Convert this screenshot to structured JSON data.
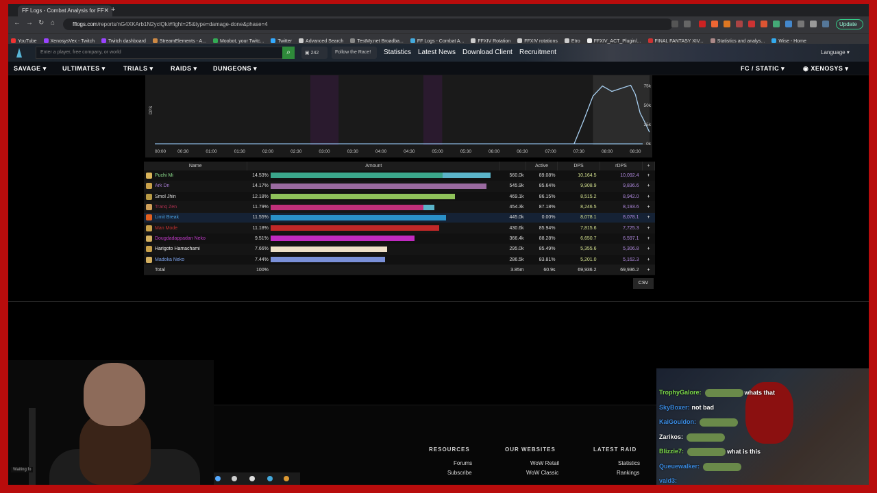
{
  "browser": {
    "tab_title": "FF Logs - Combat Analysis for FF",
    "url_domain": "fflogs.com",
    "url_path": "/reports/nG4XKArb1N2yclQk/#fight=25&type=damage-done&phase=4",
    "update_label": "Update",
    "bookmarks": [
      "YouTube",
      "XenosysVex - Twitch",
      "Twitch dashboard",
      "StreamElements - A...",
      "Moobot, your Twitc...",
      "Twitter",
      "Advanced Search",
      "TestMy.net Broadba...",
      "FF Logs - Combat A...",
      "FFXIV Rotation",
      "FFXIV rotations",
      "Etro",
      "FFXIV_ACT_Plugin/...",
      "FINAL FANTASY XIV...",
      "Statistics and analys...",
      "Wise - Home"
    ]
  },
  "site": {
    "search_placeholder": "Enter a player, free company, or world",
    "message_count": "242",
    "follow_race": "Follow the Race!",
    "top_nav": [
      "Statistics",
      "Latest News",
      "Download Client",
      "Recruitment"
    ],
    "language": "Language",
    "main_nav": [
      "SAVAGE",
      "ULTIMATES",
      "TRIALS",
      "RAIDS",
      "DUNGEONS"
    ],
    "fc_static": "FC / STATIC",
    "user": "XENOSYS"
  },
  "graph": {
    "ylabel": "DPS",
    "x_ticks": [
      "00:00",
      "00:30",
      "01:00",
      "01:30",
      "02:00",
      "02:30",
      "03:00",
      "03:30",
      "04:00",
      "04:30",
      "05:00",
      "05:30",
      "06:00",
      "06:30",
      "07:00",
      "07:30",
      "08:00",
      "08:30"
    ],
    "y_ticks": [
      "75k",
      "50k",
      "25k",
      "0k"
    ]
  },
  "chart_data": {
    "type": "line",
    "ylabel": "DPS",
    "x": [
      "07:25",
      "07:35",
      "07:45",
      "07:55",
      "08:05",
      "08:15",
      "08:25",
      "08:30",
      "08:35",
      "08:40",
      "08:45"
    ],
    "series": [
      {
        "values": [
          0,
          30000,
          62000,
          75000,
          68000,
          72000,
          76000,
          64000,
          40000,
          28000,
          15000
        ]
      }
    ],
    "ylim": [
      0,
      80000
    ],
    "highlight_ranges": [
      [
        "02:45",
        "03:15"
      ],
      [
        "04:45",
        "05:05"
      ],
      [
        "07:45",
        "08:45"
      ]
    ]
  },
  "table": {
    "headers": {
      "name": "Name",
      "amount": "Amount",
      "active": "Active",
      "dps": "DPS",
      "rdps": "rDPS",
      "plus": "+"
    },
    "rows": [
      {
        "name": "Puchi Mi",
        "pct": "14.53%",
        "amount": "560.0k",
        "active": "89.08%",
        "dps": "10,164.5",
        "rdps": "10,092.4",
        "fill": 0.98,
        "fill2": 0.22,
        "color": "#3aa58a",
        "color2": "#5ab3c8",
        "namecolor": "#8ee08e",
        "icon": "#d9b45a"
      },
      {
        "name": "Ark Dn",
        "pct": "14.17%",
        "amount": "545.9k",
        "active": "85.64%",
        "dps": "9,908.9",
        "rdps": "9,836.6",
        "fill": 0.96,
        "fill2": 0,
        "color": "#9a6aa0",
        "color2": "",
        "namecolor": "#a57ad0",
        "icon": "#c9a14a"
      },
      {
        "name": "Smol Jhin",
        "pct": "12.18%",
        "amount": "469.1k",
        "active": "86.15%",
        "dps": "8,515.2",
        "rdps": "8,942.0",
        "fill": 0.82,
        "fill2": 0,
        "color": "#8fc35a",
        "color2": "",
        "namecolor": "#dddddd",
        "icon": "#b89a45"
      },
      {
        "name": "Tranq Zen",
        "pct": "11.79%",
        "amount": "454.3k",
        "active": "87.18%",
        "dps": "8,246.5",
        "rdps": "8,193.6",
        "fill": 0.73,
        "fill2": 0.07,
        "color": "#c0307a",
        "color2": "#5ab3c8",
        "namecolor": "#b03050",
        "icon": "#d0a05a"
      },
      {
        "name": "Limit Break",
        "pct": "11.55%",
        "amount": "445.0k",
        "active": "0.00%",
        "dps": "8,078.1",
        "rdps": "8,078.1",
        "fill": 0.78,
        "fill2": 0,
        "color": "#2a90c8",
        "color2": "",
        "namecolor": "#4aa0e0",
        "icon": "#e06020"
      },
      {
        "name": "Man Mode",
        "pct": "11.18%",
        "amount": "430.6k",
        "active": "85.94%",
        "dps": "7,815.6",
        "rdps": "7,725.3",
        "fill": 0.75,
        "fill2": 0,
        "color": "#c02828",
        "color2": "",
        "namecolor": "#c03030",
        "icon": "#c9a14a"
      },
      {
        "name": "Dougdadappadan Neko",
        "pct": "9.51%",
        "amount": "366.4k",
        "active": "88.28%",
        "dps": "6,650.7",
        "rdps": "6,597.1",
        "fill": 0.64,
        "fill2": 0,
        "color": "#c02ac0",
        "color2": "",
        "namecolor": "#c03ac8",
        "icon": "#d4b060"
      },
      {
        "name": "Harigoto Hamachami",
        "pct": "7.66%",
        "amount": "295.0k",
        "active": "85.49%",
        "dps": "5,355.6",
        "rdps": "5,306.8",
        "fill": 0.52,
        "fill2": 0,
        "color": "#eee0c8",
        "color2": "",
        "namecolor": "#eeeeee",
        "icon": "#c9a14a"
      },
      {
        "name": "Madoka Neko",
        "pct": "7.44%",
        "amount": "286.5k",
        "active": "83.81%",
        "dps": "5,201.0",
        "rdps": "5,162.3",
        "fill": 0.51,
        "fill2": 0,
        "color": "#7a90d8",
        "color2": "",
        "namecolor": "#7aa0e8",
        "icon": "#d4b060"
      }
    ],
    "total": {
      "label": "Total",
      "pct": "100%",
      "amount": "3.85m",
      "active": "60.9s",
      "dps": "69,936.2",
      "rdps": "69,936.2"
    },
    "csv_label": "CSV"
  },
  "footer": {
    "resources_title": "RESOURCES",
    "resources": [
      "Forums",
      "Subscribe"
    ],
    "websites_title": "OUR WEBSITES",
    "websites": [
      "WoW Retail",
      "WoW Classic"
    ],
    "latest_title": "LATEST RAID",
    "latest": [
      "Statistics",
      "Rankings"
    ],
    "status": "Waiting fo"
  },
  "chat": [
    {
      "user": "TrophyGalore:",
      "msg": "whats that",
      "color": "#7ddc4a"
    },
    {
      "user": "SkyBoxer:",
      "msg": "not bad",
      "color": "#3a8ae0"
    },
    {
      "user": "KaiGouldon:",
      "msg": "",
      "color": "#3a8ae0"
    },
    {
      "user": "Zarikos:",
      "msg": "",
      "color": "#eeeeee"
    },
    {
      "user": "Blizzie7:",
      "msg": "what is this",
      "color": "#7ddc4a"
    },
    {
      "user": "Queuewalker:",
      "msg": "",
      "color": "#3a8ae0"
    },
    {
      "user": "vald3:",
      "msg": "",
      "color": "#3a8ae0"
    }
  ]
}
